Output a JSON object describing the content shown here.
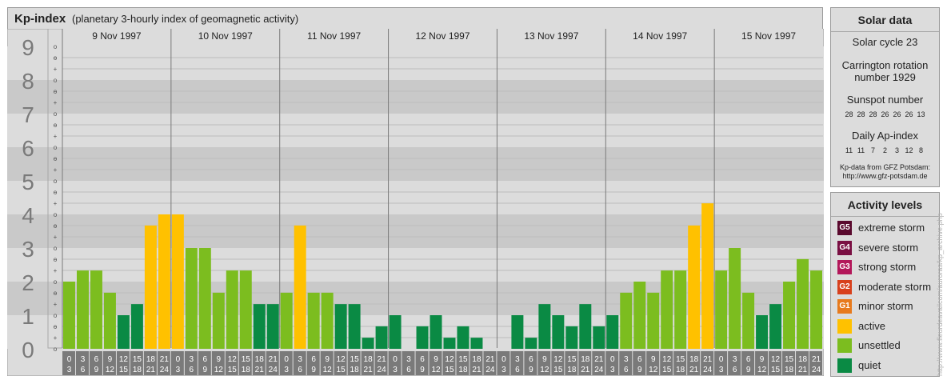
{
  "header": {
    "title": "Kp-index",
    "subtitle": "(planetary 3-hourly index of geomagnetic activity)"
  },
  "chart_data": {
    "type": "bar",
    "title": "Kp-index",
    "y_ticks": [
      "0",
      "1",
      "2",
      "3",
      "4",
      "5",
      "6",
      "7",
      "8",
      "9"
    ],
    "ylim": [
      0,
      9
    ],
    "sub_marks": [
      "o",
      "+",
      "−"
    ],
    "days": [
      "9 Nov 1997",
      "10 Nov 1997",
      "11 Nov 1997",
      "12 Nov 1997",
      "13 Nov 1997",
      "14 Nov 1997",
      "15 Nov 1997"
    ],
    "interval_starts": [
      "0",
      "3",
      "6",
      "9",
      "12",
      "15",
      "18",
      "21"
    ],
    "interval_ends": [
      "3",
      "6",
      "9",
      "12",
      "15",
      "18",
      "21",
      "24"
    ],
    "values": [
      2.0,
      2.33,
      2.33,
      1.67,
      1.0,
      1.33,
      3.67,
      4.0,
      4.0,
      3.0,
      3.0,
      1.67,
      2.33,
      2.33,
      1.33,
      1.33,
      1.67,
      3.67,
      1.67,
      1.67,
      1.33,
      1.33,
      0.33,
      0.67,
      1.0,
      0.0,
      0.67,
      1.0,
      0.33,
      0.67,
      0.33,
      0.0,
      0.0,
      1.0,
      0.33,
      1.33,
      1.0,
      0.67,
      1.33,
      0.67,
      1.0,
      1.67,
      2.0,
      1.67,
      2.33,
      2.33,
      3.67,
      4.33,
      2.33,
      3.0,
      1.67,
      1.0,
      1.33,
      2.0,
      2.67,
      2.33
    ],
    "colors": {
      "quiet": "#0a8a44",
      "unsettled": "#7cbd1f",
      "active": "#ffc100",
      "band_dark": "#c9c9c9",
      "band_light": "#dcdcdc",
      "axis_label": "#7a7a7a",
      "grid": "#bdbdbd"
    }
  },
  "solar": {
    "heading": "Solar data",
    "cycle": "Solar cycle 23",
    "carrington_line1": "Carrington rotation",
    "carrington_line2": "number 1929",
    "sunspot_heading": "Sunspot number",
    "sunspot_values": [
      "28",
      "28",
      "28",
      "26",
      "26",
      "26",
      "13"
    ],
    "ap_heading": "Daily Ap-index",
    "ap_values": [
      "11",
      "11",
      "7",
      "2",
      "3",
      "12",
      "8"
    ],
    "source_line1": "Kp-data from GFZ Potsdam:",
    "source_line2": "http://www.gfz-potsdam.de"
  },
  "legend": {
    "heading": "Activity levels",
    "items": [
      {
        "badge": "G5",
        "label": "extreme storm",
        "color": "#5a0a2e"
      },
      {
        "badge": "G4",
        "label": "severe storm",
        "color": "#7a1043"
      },
      {
        "badge": "G3",
        "label": "strong storm",
        "color": "#b3175a"
      },
      {
        "badge": "G2",
        "label": "moderate storm",
        "color": "#d8401c"
      },
      {
        "badge": "G1",
        "label": "minor storm",
        "color": "#e77a1d"
      },
      {
        "badge": "",
        "label": "active",
        "color": "#ffc100"
      },
      {
        "badge": "",
        "label": "unsettled",
        "color": "#7cbd1f"
      },
      {
        "badge": "",
        "label": "quiet",
        "color": "#0a8a44"
      }
    ]
  },
  "watermark": "http://www.fleurdeavailcom/auroras/kp_archive.php"
}
